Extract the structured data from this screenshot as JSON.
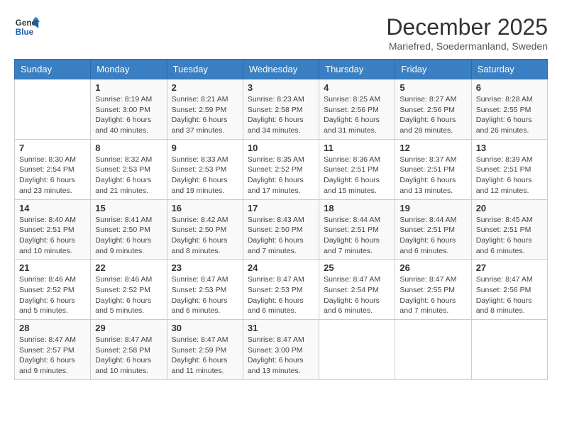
{
  "logo": {
    "line1": "General",
    "line2": "Blue"
  },
  "title": "December 2025",
  "subtitle": "Mariefred, Soedermanland, Sweden",
  "days_header": [
    "Sunday",
    "Monday",
    "Tuesday",
    "Wednesday",
    "Thursday",
    "Friday",
    "Saturday"
  ],
  "weeks": [
    [
      {
        "day": "",
        "sunrise": "",
        "sunset": "",
        "daylight": ""
      },
      {
        "day": "1",
        "sunrise": "Sunrise: 8:19 AM",
        "sunset": "Sunset: 3:00 PM",
        "daylight": "Daylight: 6 hours and 40 minutes."
      },
      {
        "day": "2",
        "sunrise": "Sunrise: 8:21 AM",
        "sunset": "Sunset: 2:59 PM",
        "daylight": "Daylight: 6 hours and 37 minutes."
      },
      {
        "day": "3",
        "sunrise": "Sunrise: 8:23 AM",
        "sunset": "Sunset: 2:58 PM",
        "daylight": "Daylight: 6 hours and 34 minutes."
      },
      {
        "day": "4",
        "sunrise": "Sunrise: 8:25 AM",
        "sunset": "Sunset: 2:56 PM",
        "daylight": "Daylight: 6 hours and 31 minutes."
      },
      {
        "day": "5",
        "sunrise": "Sunrise: 8:27 AM",
        "sunset": "Sunset: 2:56 PM",
        "daylight": "Daylight: 6 hours and 28 minutes."
      },
      {
        "day": "6",
        "sunrise": "Sunrise: 8:28 AM",
        "sunset": "Sunset: 2:55 PM",
        "daylight": "Daylight: 6 hours and 26 minutes."
      }
    ],
    [
      {
        "day": "7",
        "sunrise": "Sunrise: 8:30 AM",
        "sunset": "Sunset: 2:54 PM",
        "daylight": "Daylight: 6 hours and 23 minutes."
      },
      {
        "day": "8",
        "sunrise": "Sunrise: 8:32 AM",
        "sunset": "Sunset: 2:53 PM",
        "daylight": "Daylight: 6 hours and 21 minutes."
      },
      {
        "day": "9",
        "sunrise": "Sunrise: 8:33 AM",
        "sunset": "Sunset: 2:53 PM",
        "daylight": "Daylight: 6 hours and 19 minutes."
      },
      {
        "day": "10",
        "sunrise": "Sunrise: 8:35 AM",
        "sunset": "Sunset: 2:52 PM",
        "daylight": "Daylight: 6 hours and 17 minutes."
      },
      {
        "day": "11",
        "sunrise": "Sunrise: 8:36 AM",
        "sunset": "Sunset: 2:51 PM",
        "daylight": "Daylight: 6 hours and 15 minutes."
      },
      {
        "day": "12",
        "sunrise": "Sunrise: 8:37 AM",
        "sunset": "Sunset: 2:51 PM",
        "daylight": "Daylight: 6 hours and 13 minutes."
      },
      {
        "day": "13",
        "sunrise": "Sunrise: 8:39 AM",
        "sunset": "Sunset: 2:51 PM",
        "daylight": "Daylight: 6 hours and 12 minutes."
      }
    ],
    [
      {
        "day": "14",
        "sunrise": "Sunrise: 8:40 AM",
        "sunset": "Sunset: 2:51 PM",
        "daylight": "Daylight: 6 hours and 10 minutes."
      },
      {
        "day": "15",
        "sunrise": "Sunrise: 8:41 AM",
        "sunset": "Sunset: 2:50 PM",
        "daylight": "Daylight: 6 hours and 9 minutes."
      },
      {
        "day": "16",
        "sunrise": "Sunrise: 8:42 AM",
        "sunset": "Sunset: 2:50 PM",
        "daylight": "Daylight: 6 hours and 8 minutes."
      },
      {
        "day": "17",
        "sunrise": "Sunrise: 8:43 AM",
        "sunset": "Sunset: 2:50 PM",
        "daylight": "Daylight: 6 hours and 7 minutes."
      },
      {
        "day": "18",
        "sunrise": "Sunrise: 8:44 AM",
        "sunset": "Sunset: 2:51 PM",
        "daylight": "Daylight: 6 hours and 7 minutes."
      },
      {
        "day": "19",
        "sunrise": "Sunrise: 8:44 AM",
        "sunset": "Sunset: 2:51 PM",
        "daylight": "Daylight: 6 hours and 6 minutes."
      },
      {
        "day": "20",
        "sunrise": "Sunrise: 8:45 AM",
        "sunset": "Sunset: 2:51 PM",
        "daylight": "Daylight: 6 hours and 6 minutes."
      }
    ],
    [
      {
        "day": "21",
        "sunrise": "Sunrise: 8:46 AM",
        "sunset": "Sunset: 2:52 PM",
        "daylight": "Daylight: 6 hours and 5 minutes."
      },
      {
        "day": "22",
        "sunrise": "Sunrise: 8:46 AM",
        "sunset": "Sunset: 2:52 PM",
        "daylight": "Daylight: 6 hours and 5 minutes."
      },
      {
        "day": "23",
        "sunrise": "Sunrise: 8:47 AM",
        "sunset": "Sunset: 2:53 PM",
        "daylight": "Daylight: 6 hours and 6 minutes."
      },
      {
        "day": "24",
        "sunrise": "Sunrise: 8:47 AM",
        "sunset": "Sunset: 2:53 PM",
        "daylight": "Daylight: 6 hours and 6 minutes."
      },
      {
        "day": "25",
        "sunrise": "Sunrise: 8:47 AM",
        "sunset": "Sunset: 2:54 PM",
        "daylight": "Daylight: 6 hours and 6 minutes."
      },
      {
        "day": "26",
        "sunrise": "Sunrise: 8:47 AM",
        "sunset": "Sunset: 2:55 PM",
        "daylight": "Daylight: 6 hours and 7 minutes."
      },
      {
        "day": "27",
        "sunrise": "Sunrise: 8:47 AM",
        "sunset": "Sunset: 2:56 PM",
        "daylight": "Daylight: 6 hours and 8 minutes."
      }
    ],
    [
      {
        "day": "28",
        "sunrise": "Sunrise: 8:47 AM",
        "sunset": "Sunset: 2:57 PM",
        "daylight": "Daylight: 6 hours and 9 minutes."
      },
      {
        "day": "29",
        "sunrise": "Sunrise: 8:47 AM",
        "sunset": "Sunset: 2:58 PM",
        "daylight": "Daylight: 6 hours and 10 minutes."
      },
      {
        "day": "30",
        "sunrise": "Sunrise: 8:47 AM",
        "sunset": "Sunset: 2:59 PM",
        "daylight": "Daylight: 6 hours and 11 minutes."
      },
      {
        "day": "31",
        "sunrise": "Sunrise: 8:47 AM",
        "sunset": "Sunset: 3:00 PM",
        "daylight": "Daylight: 6 hours and 13 minutes."
      },
      {
        "day": "",
        "sunrise": "",
        "sunset": "",
        "daylight": ""
      },
      {
        "day": "",
        "sunrise": "",
        "sunset": "",
        "daylight": ""
      },
      {
        "day": "",
        "sunrise": "",
        "sunset": "",
        "daylight": ""
      }
    ]
  ]
}
